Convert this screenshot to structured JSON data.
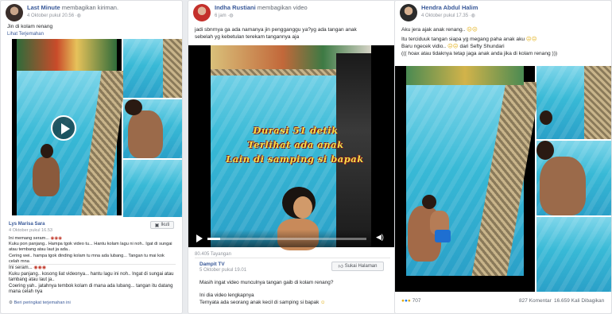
{
  "card1": {
    "author": "Last Minute",
    "action": "membagikan kiriman.",
    "time": "4 Oktober pukul 20.56",
    "caption": "Jin di kolam renang",
    "translate": "Lihat Terjemahan",
    "commenter": "Lys Marisa Sara",
    "comment_time": "4 Oktober pukul 16.53",
    "follow_label": "Ikuti",
    "comment_lines": [
      "Ini memang seram... ",
      "Kuku pon panjang.. Hampa tgok video tu... Hantu kolam lagu ni noh.. Igat di sungai atau tembang atau laut ja ada..",
      "Cering wei.. hampa tgok dinding kolam tu mna ada lubang... Tangan tu mai kok celah mna"
    ],
    "translated_lines": [
      "Ini seram... ",
      "Kuku panjang.. kosong liat videonya... hantu lagu ini noh.. Ingat di sungai atau tambang atau laut ja..",
      "Coering yah.. jatahnya tembok kolam di mana ada lubang... tangan itu datang mana celah nya"
    ],
    "rate_translation": "Beri peringkat terjemahan ini"
  },
  "card2": {
    "author": "Indha Rustiani",
    "action": "membagikan video",
    "time": "6 jam",
    "caption": "jadi sbnrnya ga ada namanya jin pengganggu ya?yg ada tangan anak sebelah yg kebetulan terekam tangannya aja",
    "caption_highlight": "jin",
    "overlay_line1": "Durasi 51 detik",
    "overlay_line2": "Terlihat ada anak",
    "overlay_line3": "Lain di samping si bapak",
    "views": "80.405 Tayangan",
    "page_name": "Dampit TV",
    "page_time": "5 Oktober pukul 19.01",
    "like_page": "Sukai Halaman",
    "post_text": "Masih ingat video munculnya tangan gaib di kolam renang?",
    "post_text2": "Ini dia video lengkapnya",
    "post_text3": "Ternyata ada seorang anak kecil di samping si bapak"
  },
  "card3": {
    "author": "Hendra Abdul Halim",
    "time": "4 Oktober pukul 17.35",
    "line1": "Aku jera ajak anak renang..",
    "line2": "Itu terciduuk tangan siapa yg megang paha anak aku",
    "line3": "Baru ngecek vidio..",
    "line3b": "dari Sefty Shundari",
    "line4": "((( hoax atau tidaknya tetap jaga anak anda jika di kolam renang )))",
    "reactions": "707",
    "comments": "827 Komentar",
    "shares": "16.659 Kali Dibagikan"
  },
  "colors": {
    "link": "#385898",
    "overlay_text": "#f7e04a",
    "pool": "#38b9d6"
  }
}
